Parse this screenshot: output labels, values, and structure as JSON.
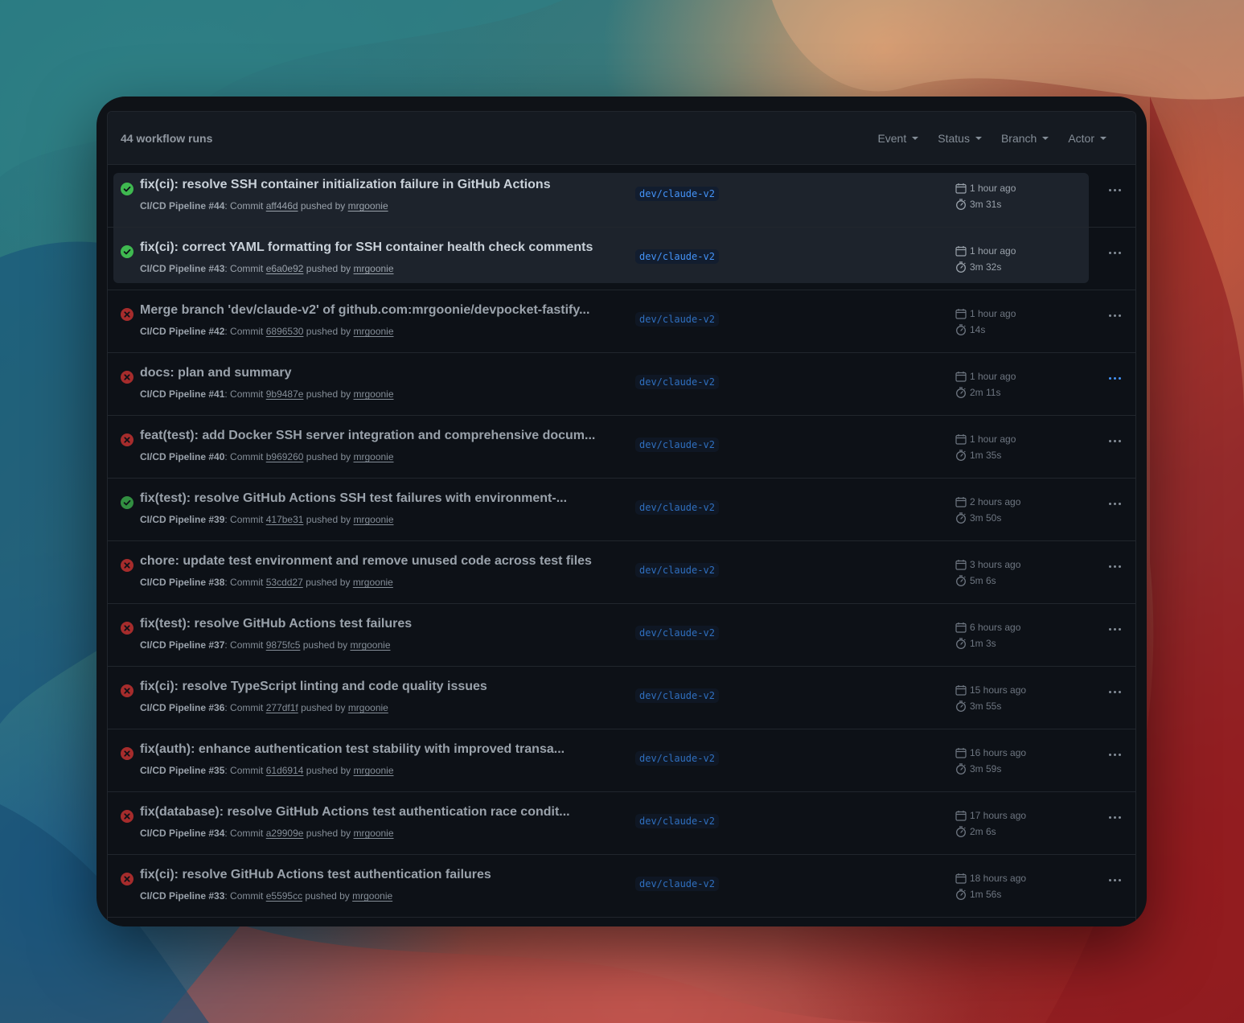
{
  "header": {
    "run_count": "44 workflow runs",
    "filters": [
      "Event",
      "Status",
      "Branch",
      "Actor"
    ]
  },
  "runs": [
    {
      "status": "success",
      "title": "fix(ci): resolve SSH container initialization failure in GitHub Actions",
      "workflow": "CI/CD Pipeline #44",
      "commit": "aff446d",
      "actor": "mrgoonie",
      "branch": "dev/claude-v2",
      "time": "1 hour ago",
      "duration": "3m 31s"
    },
    {
      "status": "success",
      "title": "fix(ci): correct YAML formatting for SSH container health check comments",
      "workflow": "CI/CD Pipeline #43",
      "commit": "e6a0e92",
      "actor": "mrgoonie",
      "branch": "dev/claude-v2",
      "time": "1 hour ago",
      "duration": "3m 32s"
    },
    {
      "status": "failure",
      "title": "Merge branch 'dev/claude-v2' of github.com:mrgoonie/devpocket-fastify...",
      "workflow": "CI/CD Pipeline #42",
      "commit": "6896530",
      "actor": "mrgoonie",
      "branch": "dev/claude-v2",
      "time": "1 hour ago",
      "duration": "14s"
    },
    {
      "status": "failure",
      "title": "docs: plan and summary",
      "workflow": "CI/CD Pipeline #41",
      "commit": "9b9487e",
      "actor": "mrgoonie",
      "branch": "dev/claude-v2",
      "time": "1 hour ago",
      "duration": "2m 11s"
    },
    {
      "status": "failure",
      "title": "feat(test): add Docker SSH server integration and comprehensive docum...",
      "workflow": "CI/CD Pipeline #40",
      "commit": "b969260",
      "actor": "mrgoonie",
      "branch": "dev/claude-v2",
      "time": "1 hour ago",
      "duration": "1m 35s"
    },
    {
      "status": "success",
      "title": "fix(test): resolve GitHub Actions SSH test failures with environment-...",
      "workflow": "CI/CD Pipeline #39",
      "commit": "417be31",
      "actor": "mrgoonie",
      "branch": "dev/claude-v2",
      "time": "2 hours ago",
      "duration": "3m 50s"
    },
    {
      "status": "failure",
      "title": "chore: update test environment and remove unused code across test files",
      "workflow": "CI/CD Pipeline #38",
      "commit": "53cdd27",
      "actor": "mrgoonie",
      "branch": "dev/claude-v2",
      "time": "3 hours ago",
      "duration": "5m 6s"
    },
    {
      "status": "failure",
      "title": "fix(test): resolve GitHub Actions test failures",
      "workflow": "CI/CD Pipeline #37",
      "commit": "9875fc5",
      "actor": "mrgoonie",
      "branch": "dev/claude-v2",
      "time": "6 hours ago",
      "duration": "1m 3s"
    },
    {
      "status": "failure",
      "title": "fix(ci): resolve TypeScript linting and code quality issues",
      "workflow": "CI/CD Pipeline #36",
      "commit": "277df1f",
      "actor": "mrgoonie",
      "branch": "dev/claude-v2",
      "time": "15 hours ago",
      "duration": "3m 55s"
    },
    {
      "status": "failure",
      "title": "fix(auth): enhance authentication test stability with improved transa...",
      "workflow": "CI/CD Pipeline #35",
      "commit": "61d6914",
      "actor": "mrgoonie",
      "branch": "dev/claude-v2",
      "time": "16 hours ago",
      "duration": "3m 59s"
    },
    {
      "status": "failure",
      "title": "fix(database): resolve GitHub Actions test authentication race condit...",
      "workflow": "CI/CD Pipeline #34",
      "commit": "a29909e",
      "actor": "mrgoonie",
      "branch": "dev/claude-v2",
      "time": "17 hours ago",
      "duration": "2m 6s"
    },
    {
      "status": "failure",
      "title": "fix(ci): resolve GitHub Actions test authentication failures",
      "workflow": "CI/CD Pipeline #33",
      "commit": "e5595cc",
      "actor": "mrgoonie",
      "branch": "dev/claude-v2",
      "time": "18 hours ago",
      "duration": "1m 56s"
    }
  ],
  "labels": {
    "commit_prefix": ": Commit ",
    "pushed_by": " pushed by "
  },
  "colors": {
    "success": "#3fb950",
    "failure": "#da3633",
    "link": "#4493f8"
  }
}
